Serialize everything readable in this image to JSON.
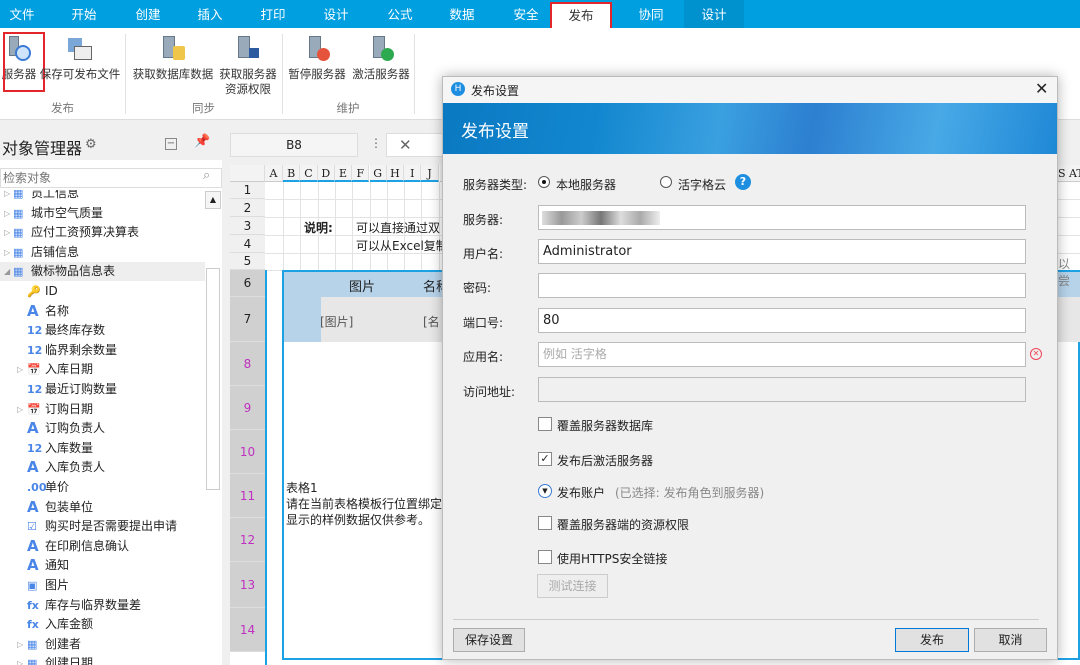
{
  "tabs": [
    "文件",
    "开始",
    "创建",
    "插入",
    "打印",
    "设计",
    "公式",
    "数据",
    "安全",
    "发布",
    "协同",
    "设计"
  ],
  "ribbon": {
    "buttons": [
      "服务器",
      "保存可发布文件",
      "获取数据库数据",
      "获取服务器",
      "资源权限",
      "暂停服务器",
      "激活服务器"
    ],
    "groups": [
      "发布",
      "同步",
      "维护"
    ]
  },
  "panel": {
    "title": "对象管理器",
    "search_placeholder": "检索对象",
    "items": [
      {
        "label": "员工信息",
        "icon": "table-icon",
        "level": 0
      },
      {
        "label": "城市空气质量",
        "icon": "table-icon",
        "level": 0
      },
      {
        "label": "应付工资预算决算表",
        "icon": "table-icon",
        "level": 0
      },
      {
        "label": "店铺信息",
        "icon": "table-icon",
        "level": 0
      },
      {
        "label": "徽标物品信息表",
        "icon": "table-icon",
        "level": 0,
        "expanded": true
      },
      {
        "label": "ID",
        "icon": "key-icon",
        "level": 1
      },
      {
        "label": "名称",
        "icon": "text-icon",
        "level": 1
      },
      {
        "label": "最终库存数",
        "icon": "number-icon",
        "level": 1
      },
      {
        "label": "临界剩余数量",
        "icon": "number-icon",
        "level": 1
      },
      {
        "label": "入库日期",
        "icon": "date-icon",
        "level": 1
      },
      {
        "label": "最近订购数量",
        "icon": "number-icon",
        "level": 1
      },
      {
        "label": "订购日期",
        "icon": "date-icon",
        "level": 1
      },
      {
        "label": "订购负责人",
        "icon": "text-icon",
        "level": 1
      },
      {
        "label": "入库数量",
        "icon": "number-icon",
        "level": 1
      },
      {
        "label": "入库负责人",
        "icon": "text-icon",
        "level": 1
      },
      {
        "label": "单价",
        "icon": "decimal-icon",
        "level": 1
      },
      {
        "label": "包装单位",
        "icon": "text-icon",
        "level": 1
      },
      {
        "label": "购买时是否需要提出申请",
        "icon": "checkbox-icon",
        "level": 1
      },
      {
        "label": "在印刷信息确认",
        "icon": "text-icon",
        "level": 1
      },
      {
        "label": "通知",
        "icon": "text-icon",
        "level": 1
      },
      {
        "label": "图片",
        "icon": "image-icon",
        "level": 1
      },
      {
        "label": "库存与临界数量差",
        "icon": "formula-icon",
        "level": 1
      },
      {
        "label": "入库金额",
        "icon": "formula-icon",
        "level": 1
      },
      {
        "label": "创建者",
        "icon": "table-icon",
        "level": 1
      },
      {
        "label": "创建日期",
        "icon": "table-icon",
        "level": 1
      }
    ]
  },
  "formula": {
    "cell": "B8",
    "cancel": "✕"
  },
  "sheet": {
    "columns": [
      "A",
      "B",
      "C",
      "D",
      "E",
      "F",
      "G",
      "H",
      "I",
      "J"
    ],
    "right_cols": "S AT",
    "rows": [
      "1",
      "2",
      "3",
      "4",
      "5",
      "6",
      "7",
      "8",
      "9",
      "10",
      "11",
      "12",
      "13",
      "14"
    ],
    "note_label": "说明:",
    "note1": "可以直接通过双",
    "note2": "可以从Excel复制",
    "right_note": "以尝",
    "h_image": "图片",
    "h_name": "名称",
    "c_image": "[图片]",
    "c_name": "[名",
    "table_title": "表格1",
    "table_l1": "请在当前表格模板行位置绑定",
    "table_l2": "显示的样例数据仅供参考。"
  },
  "dialog": {
    "title": "发布设置",
    "banner": "发布设置",
    "server_type_label": "服务器类型:",
    "opt_local": "本地服务器",
    "opt_cloud": "活字格云",
    "server_label": "服务器:",
    "user_label": "用户名:",
    "user_value": "Administrator",
    "pwd_label": "密码:",
    "port_label": "端口号:",
    "port_value": "80",
    "app_label": "应用名:",
    "app_placeholder": "例如 活字格",
    "url_label": "访问地址:",
    "cb_overwrite_db": "覆盖服务器数据库",
    "cb_activate": "发布后激活服务器",
    "publish_account": "发布账户",
    "publish_account_note": "(已选择: 发布角色到服务器)",
    "cb_overwrite_perm": "覆盖服务器端的资源权限",
    "cb_https": "使用HTTPS安全链接",
    "test": "测试连接",
    "save": "保存设置",
    "publish": "发布",
    "cancel": "取消"
  },
  "colors": {
    "accent": "#009fe0",
    "highlight": "#e3262c"
  }
}
